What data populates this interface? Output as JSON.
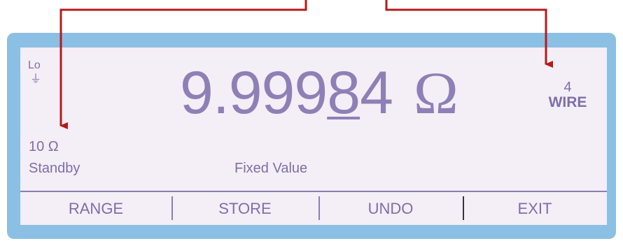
{
  "display": {
    "lo_label": "Lo",
    "ground_symbol": "⏚",
    "reading": {
      "digits_before_cursor": "9.999",
      "cursor_digit": "8",
      "digits_after_cursor": "4",
      "unit": "Ω"
    },
    "wire": {
      "number": "4",
      "label": "WIRE"
    },
    "range": "10 Ω",
    "status": "Standby",
    "mode": "Fixed Value"
  },
  "softkeys": [
    "RANGE",
    "STORE",
    "UNDO",
    "EXIT"
  ],
  "colors": {
    "bezel": "#8cbfe4",
    "lcd_background": "#f4eef6",
    "lcd_text": "#7f6ea9",
    "callout_arrow": "#b51b1b"
  }
}
